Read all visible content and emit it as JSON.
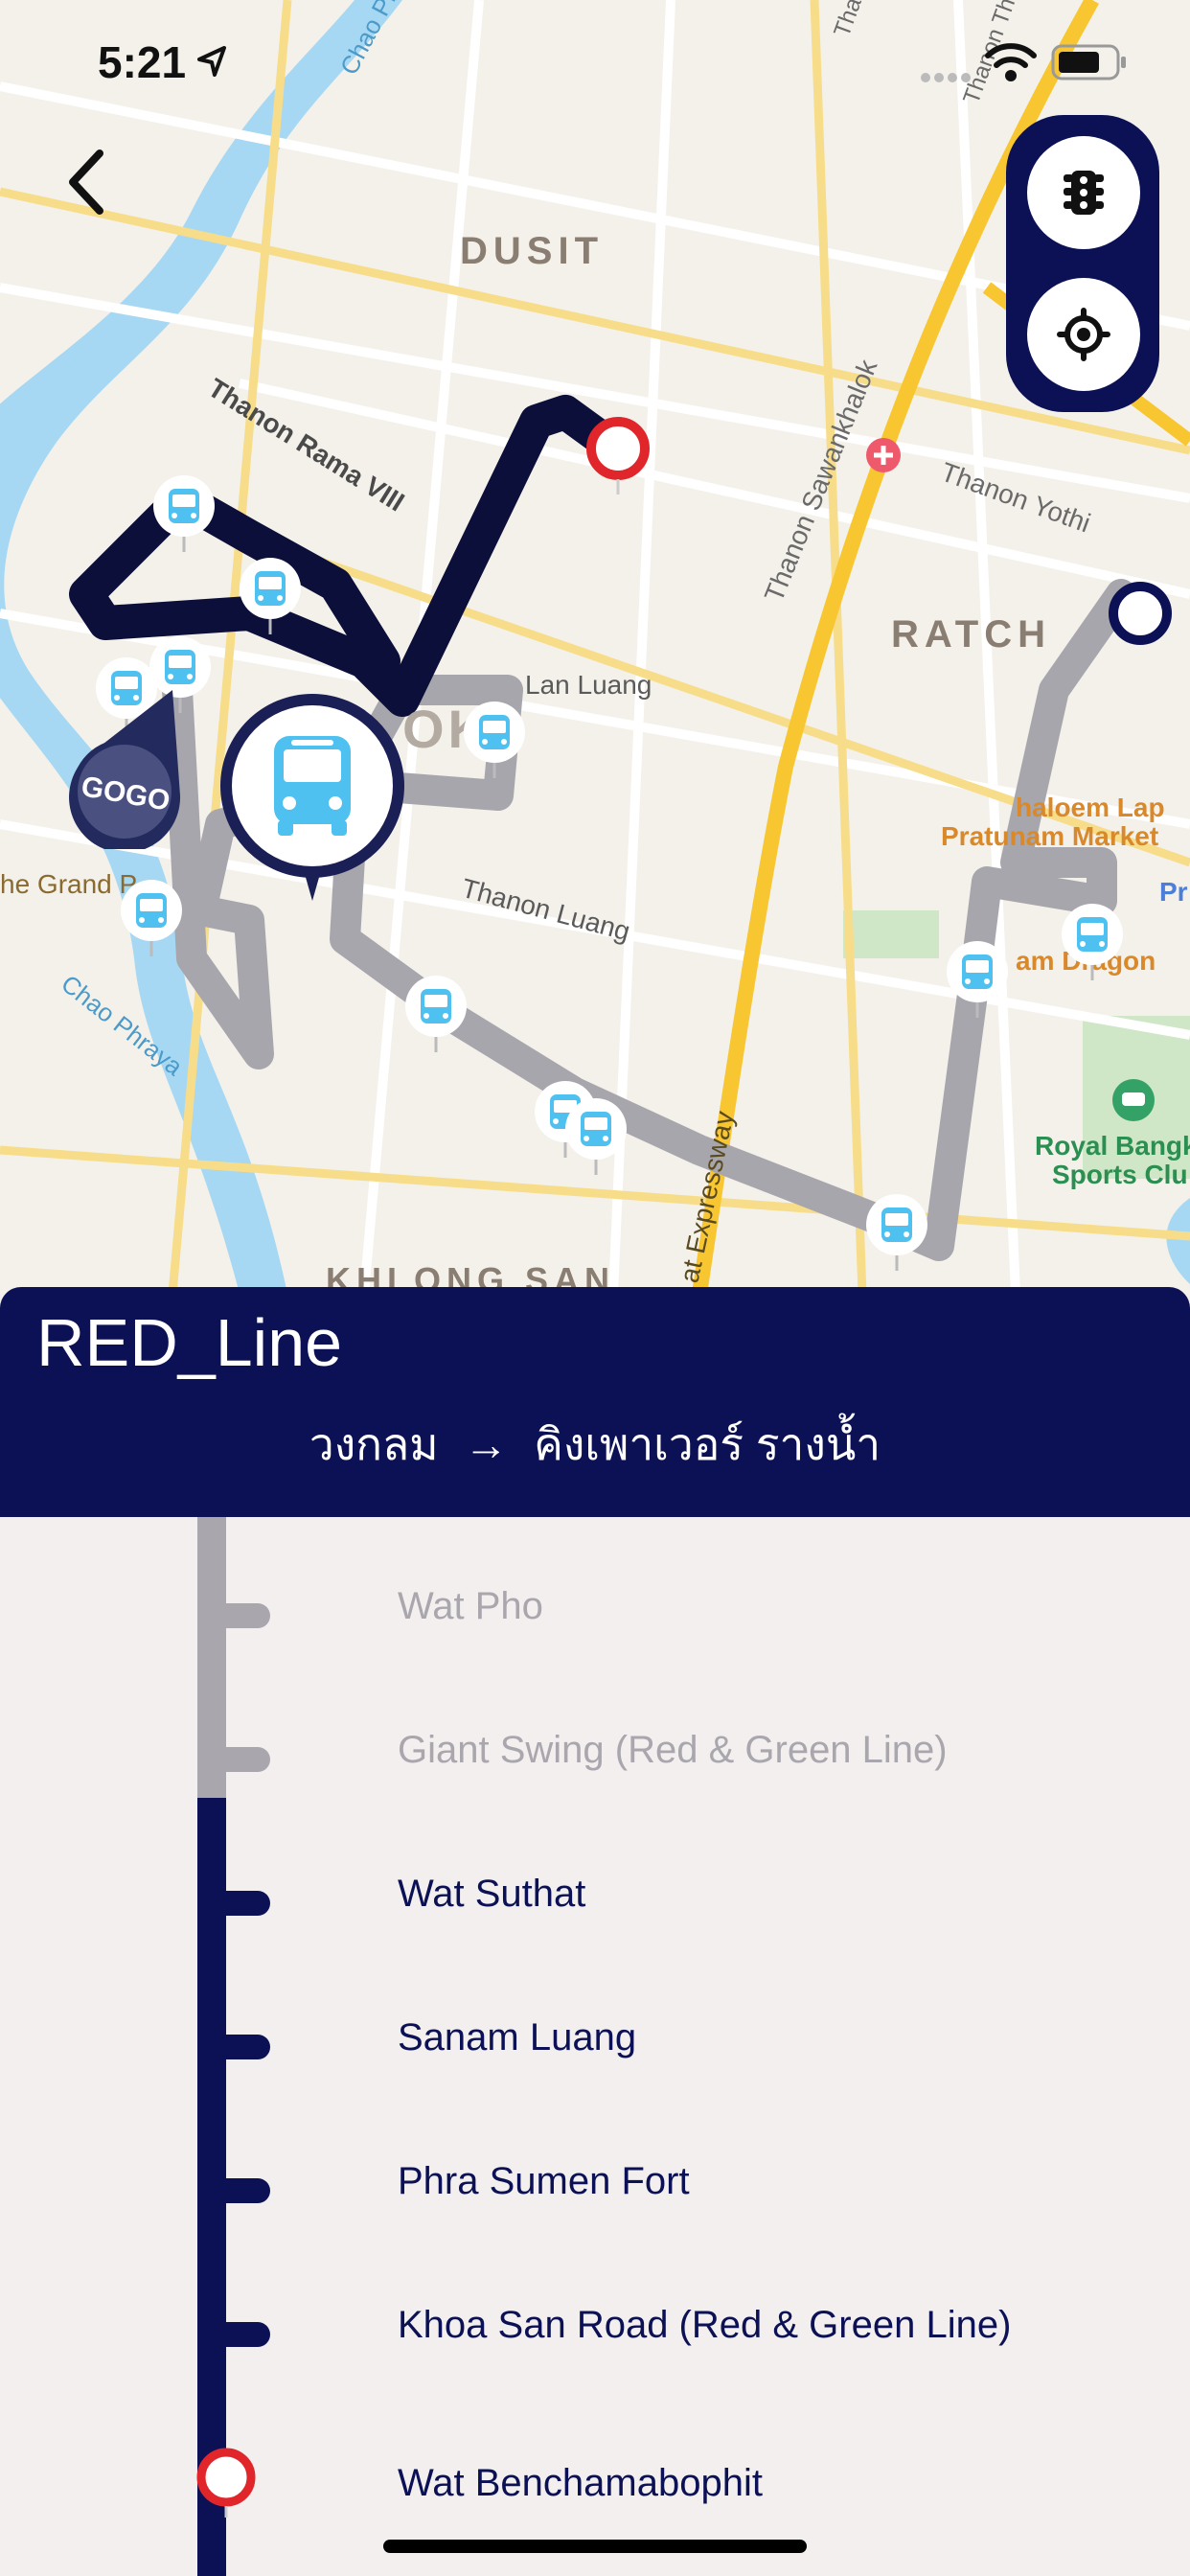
{
  "status_bar": {
    "time": "5:21"
  },
  "map": {
    "labels": {
      "dusit": "DUSIT",
      "ratch": "RATCH",
      "rama8": "Thanon Rama VIII",
      "sawankhalok": "Thanon Sawankhalok",
      "yothi": "Thanon Yothi",
      "lan_luang": "Lan Luang",
      "thanon_luang": "Thanon Luang",
      "chao_phraya": "Chao Phraya",
      "chao_phraya2": "Chao Phra",
      "grand_palace": "he Grand P",
      "khlong_san": "KHLONG SAN",
      "expressway": "at Expressway",
      "thanon_th": "Thanon Th",
      "tha": "Tha",
      "ok": "OK",
      "charoen_lap": "haloem Lap",
      "pratunam": "Pratunam Market",
      "pr": "Pr",
      "dragon": "am Dragon",
      "royal": "Royal Bangk",
      "sports": "Sports Clu"
    },
    "logo_text": "GOGO"
  },
  "route": {
    "title": "RED_Line",
    "from": "วงกลม",
    "arrow": "→",
    "to": "คิงเพาเวอร์ รางน้ำ"
  },
  "stops": [
    {
      "name": "Wat Pho",
      "passed": true
    },
    {
      "name": "Giant Swing (Red & Green Line)",
      "passed": true
    },
    {
      "name": "Wat Suthat",
      "passed": false
    },
    {
      "name": "Sanam Luang",
      "passed": false
    },
    {
      "name": "Phra Sumen Fort",
      "passed": false
    },
    {
      "name": "Khoa San Road (Red & Green Line)",
      "passed": false
    },
    {
      "name": "Wat Benchamabophit",
      "passed": false,
      "terminal": true
    }
  ],
  "icons": [
    "back-arrow-icon",
    "traffic-light-icon",
    "locate-icon",
    "bus-icon",
    "location-arrow-icon",
    "wifi-icon",
    "battery-icon"
  ],
  "colors": {
    "navy": "#0b1154",
    "passed_gray": "#a9a7ad",
    "terminal_red": "#e0262b",
    "bus_blue": "#4fc1f0"
  }
}
